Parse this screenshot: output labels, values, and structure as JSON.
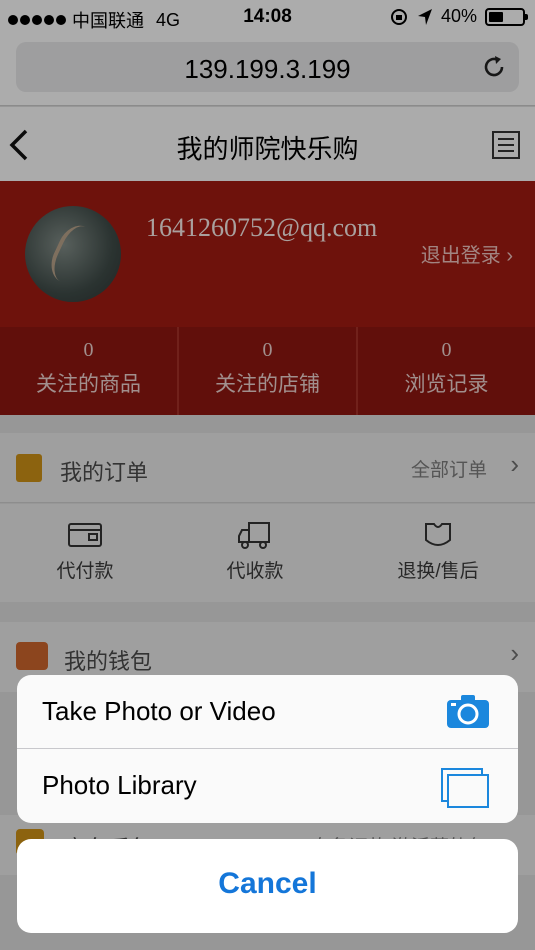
{
  "status_bar": {
    "carrier": "中国联通",
    "network": "4G",
    "time": "14:08",
    "battery": "40%"
  },
  "browser": {
    "url": "139.199.3.199"
  },
  "nav": {
    "title": "我的师院快乐购"
  },
  "profile": {
    "email": "1641260752@qq.com",
    "logout_label": "退出登录 ›",
    "stats": [
      {
        "count": "0",
        "label": "关注的商品"
      },
      {
        "count": "0",
        "label": "关注的店铺"
      },
      {
        "count": "0",
        "label": "浏览记录"
      }
    ]
  },
  "orders": {
    "title": "我的订单",
    "all_label": "全部订单",
    "tabs": [
      {
        "label": "代付款",
        "icon": "wallet-card-icon"
      },
      {
        "label": "代收款",
        "icon": "delivery-truck-icon"
      },
      {
        "label": "退换/售后",
        "icon": "return-service-icon"
      }
    ]
  },
  "wallet": {
    "title": "我的钱包"
  },
  "hidden_row": {
    "title": "宝车乐包",
    "right": "自备证款 激活菜轨包"
  },
  "action_sheet": {
    "items": [
      {
        "label": "Take Photo or Video",
        "icon": "camera-icon"
      },
      {
        "label": "Photo Library",
        "icon": "photo-library-icon"
      }
    ],
    "cancel_label": "Cancel"
  },
  "colors": {
    "header_red": "#9e1a12",
    "ios_blue": "#1476d9"
  }
}
